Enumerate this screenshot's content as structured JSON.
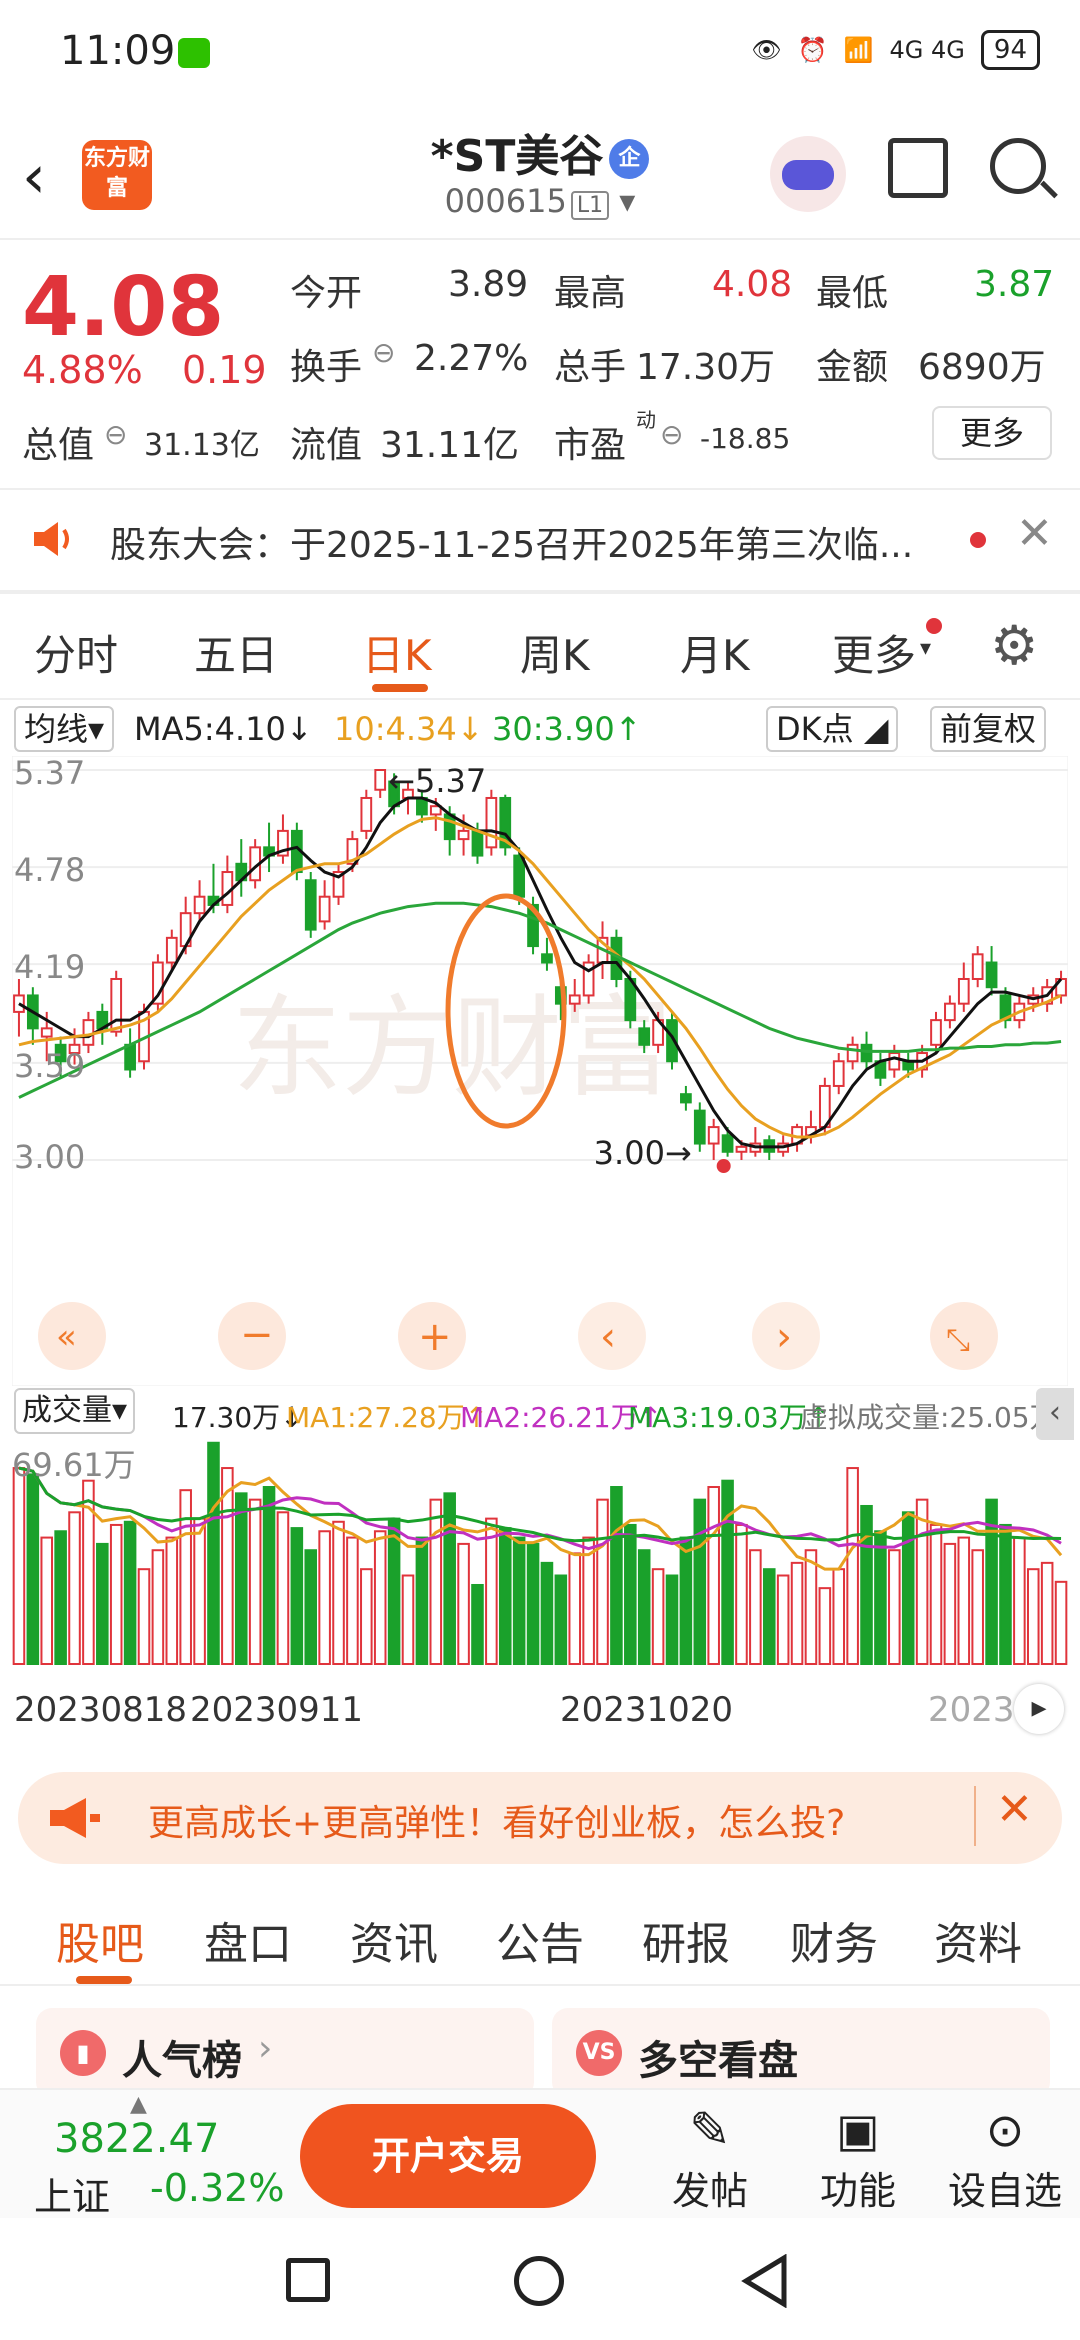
{
  "status_bar": {
    "time": "11:09",
    "signal": "4G 4G",
    "battery": "94"
  },
  "header": {
    "logo_text": "东方财富",
    "title": "*ST美谷",
    "badge": "企",
    "code": "000615",
    "level": "L1"
  },
  "quote": {
    "price": "4.08",
    "change_pct": "4.88%",
    "change": "0.19",
    "open_label": "今开",
    "open": "3.89",
    "high_label": "最高",
    "high": "4.08",
    "low_label": "最低",
    "low": "3.87",
    "turnover_label": "换手",
    "turnover": "2.27%",
    "volume_label": "总手",
    "volume": "17.30万",
    "amount_label": "金额",
    "amount": "6890万",
    "mktcap_label": "总值",
    "mktcap": "31.13亿",
    "float_label": "流值",
    "float": "31.11亿",
    "pe_label": "市盈",
    "pe_sup": "动",
    "pe": "-18.85",
    "more": "更多"
  },
  "notice": {
    "text": "股东大会：于2025-11-25召开2025年第三次临..."
  },
  "tabs": [
    "分时",
    "五日",
    "日K",
    "周K",
    "月K",
    "更多"
  ],
  "ma": {
    "label": "均线",
    "ma5": "MA5:4.10",
    "ma10": "10:4.34",
    "ma30": "30:3.90",
    "dk": "DK点",
    "adjust": "前复权"
  },
  "axis": {
    "y1": "5.37",
    "y2": "4.78",
    "y3": "4.19",
    "y4": "3.59",
    "y5": "3.00",
    "high_mark": "5.37",
    "low_mark": "3.00"
  },
  "volume": {
    "label": "成交量",
    "value": "17.30万",
    "ma1": "MA1:27.28万",
    "ma2": "MA2:26.21万",
    "ma3": "MA3:19.03万",
    "virtual": "虚拟成交量:25.05万",
    "max": "69.61万"
  },
  "dates": {
    "d1": "20230818",
    "d2": "20230911",
    "d3": "20231020",
    "d4": "2023"
  },
  "banner": {
    "text": "更高成长+更高弹性！看好创业板，怎么投?"
  },
  "bottom_tabs": [
    "股吧",
    "盘口",
    "资讯",
    "公告",
    "研报",
    "财务",
    "资料"
  ],
  "cards": {
    "c1": "人气榜",
    "c2": "多空看盘",
    "vs": "VS"
  },
  "footer": {
    "index_value": "3822.47",
    "index_name": "上证",
    "index_change": "-0.32%",
    "trade": "开户交易",
    "post": "发帖",
    "func": "功能",
    "custom": "设自选"
  },
  "colors": {
    "up": "#e0343b",
    "down": "#1aa12b",
    "accent": "#e65a1a",
    "ma5": "#111111",
    "ma10": "#e8a020",
    "ma30": "#2aa63a"
  },
  "chart_data": {
    "type": "candlestick",
    "ylim": [
      3.0,
      5.37
    ],
    "y_ticks": [
      5.37,
      4.78,
      4.19,
      3.59,
      3.0
    ],
    "candles": [
      [
        3.9,
        4.0,
        4.1,
        3.75
      ],
      [
        4.0,
        3.8,
        4.05,
        3.7
      ],
      [
        3.75,
        3.8,
        3.9,
        3.6
      ],
      [
        3.7,
        3.6,
        3.75,
        3.5
      ],
      [
        3.65,
        3.7,
        3.8,
        3.58
      ],
      [
        3.7,
        3.85,
        3.9,
        3.65
      ],
      [
        3.9,
        3.8,
        3.95,
        3.7
      ],
      [
        3.78,
        4.1,
        4.15,
        3.75
      ],
      [
        3.7,
        3.55,
        3.8,
        3.5
      ],
      [
        3.6,
        3.9,
        3.95,
        3.55
      ],
      [
        3.95,
        4.2,
        4.25,
        3.9
      ],
      [
        4.2,
        4.35,
        4.4,
        4.15
      ],
      [
        4.3,
        4.5,
        4.6,
        4.25
      ],
      [
        4.5,
        4.6,
        4.7,
        4.45
      ],
      [
        4.6,
        4.55,
        4.8,
        4.5
      ],
      [
        4.55,
        4.75,
        4.85,
        4.5
      ],
      [
        4.8,
        4.7,
        4.95,
        4.6
      ],
      [
        4.7,
        4.9,
        4.95,
        4.65
      ],
      [
        4.9,
        4.85,
        5.05,
        4.75
      ],
      [
        4.85,
        5.0,
        5.1,
        4.8
      ],
      [
        5.0,
        4.75,
        5.05,
        4.7
      ],
      [
        4.7,
        4.4,
        4.75,
        4.35
      ],
      [
        4.45,
        4.6,
        4.7,
        4.4
      ],
      [
        4.6,
        4.75,
        4.8,
        4.55
      ],
      [
        4.8,
        4.95,
        5.0,
        4.75
      ],
      [
        5.0,
        5.2,
        5.25,
        4.95
      ],
      [
        5.25,
        5.37,
        5.37,
        5.2
      ],
      [
        5.3,
        5.15,
        5.35,
        5.1
      ],
      [
        5.2,
        5.25,
        5.3,
        5.1
      ],
      [
        5.2,
        5.1,
        5.25,
        5.05
      ],
      [
        5.1,
        5.15,
        5.2,
        5.0
      ],
      [
        5.1,
        4.95,
        5.15,
        4.85
      ],
      [
        4.95,
        5.0,
        5.1,
        4.85
      ],
      [
        5.0,
        4.85,
        5.05,
        4.8
      ],
      [
        4.9,
        5.2,
        5.25,
        4.85
      ],
      [
        5.2,
        4.9,
        5.22,
        4.85
      ],
      [
        4.85,
        4.6,
        4.9,
        4.55
      ],
      [
        4.55,
        4.3,
        4.6,
        4.25
      ],
      [
        4.25,
        4.2,
        4.35,
        4.15
      ],
      [
        4.05,
        3.95,
        4.1,
        3.85
      ],
      [
        3.95,
        4.0,
        4.1,
        3.9
      ],
      [
        4.0,
        4.2,
        4.25,
        3.95
      ],
      [
        4.2,
        4.35,
        4.45,
        4.1
      ],
      [
        4.35,
        4.1,
        4.4,
        4.05
      ],
      [
        4.1,
        3.85,
        4.15,
        3.8
      ],
      [
        3.8,
        3.7,
        3.85,
        3.65
      ],
      [
        3.7,
        3.85,
        3.9,
        3.65
      ],
      [
        3.85,
        3.6,
        3.9,
        3.55
      ],
      [
        3.4,
        3.35,
        3.45,
        3.3
      ],
      [
        3.3,
        3.1,
        3.35,
        3.05
      ],
      [
        3.1,
        3.2,
        3.25,
        3.0
      ],
      [
        3.15,
        3.05,
        3.2,
        3.02
      ],
      [
        3.05,
        3.08,
        3.12,
        3.0
      ],
      [
        3.05,
        3.1,
        3.2,
        3.02
      ],
      [
        3.12,
        3.05,
        3.15,
        3.0
      ],
      [
        3.05,
        3.1,
        3.15,
        3.02
      ],
      [
        3.1,
        3.2,
        3.22,
        3.05
      ],
      [
        3.15,
        3.2,
        3.3,
        3.1
      ],
      [
        3.2,
        3.45,
        3.5,
        3.15
      ],
      [
        3.45,
        3.6,
        3.65,
        3.4
      ],
      [
        3.6,
        3.7,
        3.75,
        3.55
      ],
      [
        3.7,
        3.6,
        3.78,
        3.55
      ],
      [
        3.6,
        3.5,
        3.65,
        3.45
      ],
      [
        3.55,
        3.65,
        3.7,
        3.5
      ],
      [
        3.6,
        3.55,
        3.65,
        3.5
      ],
      [
        3.55,
        3.65,
        3.7,
        3.5
      ],
      [
        3.7,
        3.85,
        3.9,
        3.65
      ],
      [
        3.85,
        3.95,
        4.0,
        3.8
      ],
      [
        3.95,
        4.1,
        4.2,
        3.9
      ],
      [
        4.1,
        4.25,
        4.3,
        4.05
      ],
      [
        4.2,
        4.05,
        4.3,
        4.0
      ],
      [
        4.0,
        3.85,
        4.05,
        3.8
      ],
      [
        3.85,
        3.95,
        4.0,
        3.8
      ],
      [
        3.95,
        4.0,
        4.05,
        3.9
      ],
      [
        3.95,
        4.05,
        4.1,
        3.9
      ],
      [
        4.0,
        4.1,
        4.15,
        3.95
      ]
    ],
    "ma5": [
      3.95,
      3.9,
      3.85,
      3.8,
      3.75,
      3.75,
      3.8,
      3.85,
      3.85,
      3.9,
      4.0,
      4.15,
      4.3,
      4.45,
      4.55,
      4.62,
      4.7,
      4.78,
      4.85,
      4.88,
      4.9,
      4.82,
      4.75,
      4.72,
      4.78,
      4.9,
      5.05,
      5.15,
      5.2,
      5.2,
      5.17,
      5.1,
      5.05,
      5.0,
      5.0,
      4.98,
      4.88,
      4.7,
      4.52,
      4.35,
      4.2,
      4.15,
      4.2,
      4.2,
      4.1,
      3.98,
      3.85,
      3.75,
      3.6,
      3.45,
      3.3,
      3.18,
      3.1,
      3.08,
      3.08,
      3.08,
      3.1,
      3.15,
      3.2,
      3.32,
      3.45,
      3.55,
      3.6,
      3.62,
      3.6,
      3.6,
      3.65,
      3.75,
      3.85,
      3.95,
      4.02,
      4.02,
      4.0,
      3.98,
      4.0,
      4.1
    ],
    "ma10": [
      3.7,
      3.72,
      3.73,
      3.74,
      3.75,
      3.76,
      3.78,
      3.8,
      3.82,
      3.85,
      3.9,
      3.98,
      4.08,
      4.18,
      4.28,
      4.38,
      4.48,
      4.56,
      4.64,
      4.7,
      4.76,
      4.78,
      4.8,
      4.8,
      4.82,
      4.86,
      4.92,
      4.98,
      5.03,
      5.07,
      5.08,
      5.06,
      5.03,
      5.0,
      4.97,
      4.94,
      4.88,
      4.8,
      4.7,
      4.6,
      4.5,
      4.4,
      4.32,
      4.25,
      4.18,
      4.1,
      4.0,
      3.9,
      3.8,
      3.68,
      3.55,
      3.43,
      3.33,
      3.25,
      3.2,
      3.16,
      3.14,
      3.14,
      3.16,
      3.2,
      3.26,
      3.33,
      3.4,
      3.46,
      3.52,
      3.56,
      3.6,
      3.64,
      3.7,
      3.76,
      3.82,
      3.86,
      3.9,
      3.93,
      3.96,
      4.0
    ],
    "ma30": [
      3.38,
      3.42,
      3.46,
      3.5,
      3.54,
      3.58,
      3.62,
      3.66,
      3.7,
      3.74,
      3.78,
      3.82,
      3.86,
      3.9,
      3.95,
      4.0,
      4.05,
      4.1,
      4.15,
      4.2,
      4.25,
      4.3,
      4.35,
      4.4,
      4.44,
      4.47,
      4.5,
      4.52,
      4.54,
      4.55,
      4.56,
      4.56,
      4.56,
      4.55,
      4.54,
      4.52,
      4.5,
      4.47,
      4.44,
      4.4,
      4.36,
      4.32,
      4.28,
      4.24,
      4.2,
      4.16,
      4.12,
      4.08,
      4.04,
      4.0,
      3.96,
      3.92,
      3.88,
      3.84,
      3.8,
      3.77,
      3.74,
      3.72,
      3.7,
      3.68,
      3.67,
      3.66,
      3.66,
      3.66,
      3.66,
      3.67,
      3.67,
      3.68,
      3.68,
      3.69,
      3.69,
      3.7,
      3.7,
      3.71,
      3.71,
      3.72
    ],
    "volumes": [
      62,
      60,
      40,
      42,
      48,
      58,
      38,
      44,
      45,
      30,
      36,
      40,
      55,
      46,
      70,
      62,
      54,
      52,
      56,
      48,
      43,
      36,
      42,
      45,
      40,
      30,
      42,
      46,
      28,
      40,
      52,
      54,
      38,
      25,
      46,
      43,
      40,
      38,
      32,
      28,
      35,
      40,
      52,
      56,
      44,
      36,
      30,
      28,
      40,
      52,
      56,
      58,
      44,
      36,
      30,
      28,
      32,
      36,
      24,
      30,
      62,
      50,
      42,
      36,
      48,
      52,
      44,
      38,
      40,
      36,
      52,
      44,
      40,
      30,
      32,
      26
    ],
    "vol_ylim": [
      0,
      69.61
    ]
  }
}
